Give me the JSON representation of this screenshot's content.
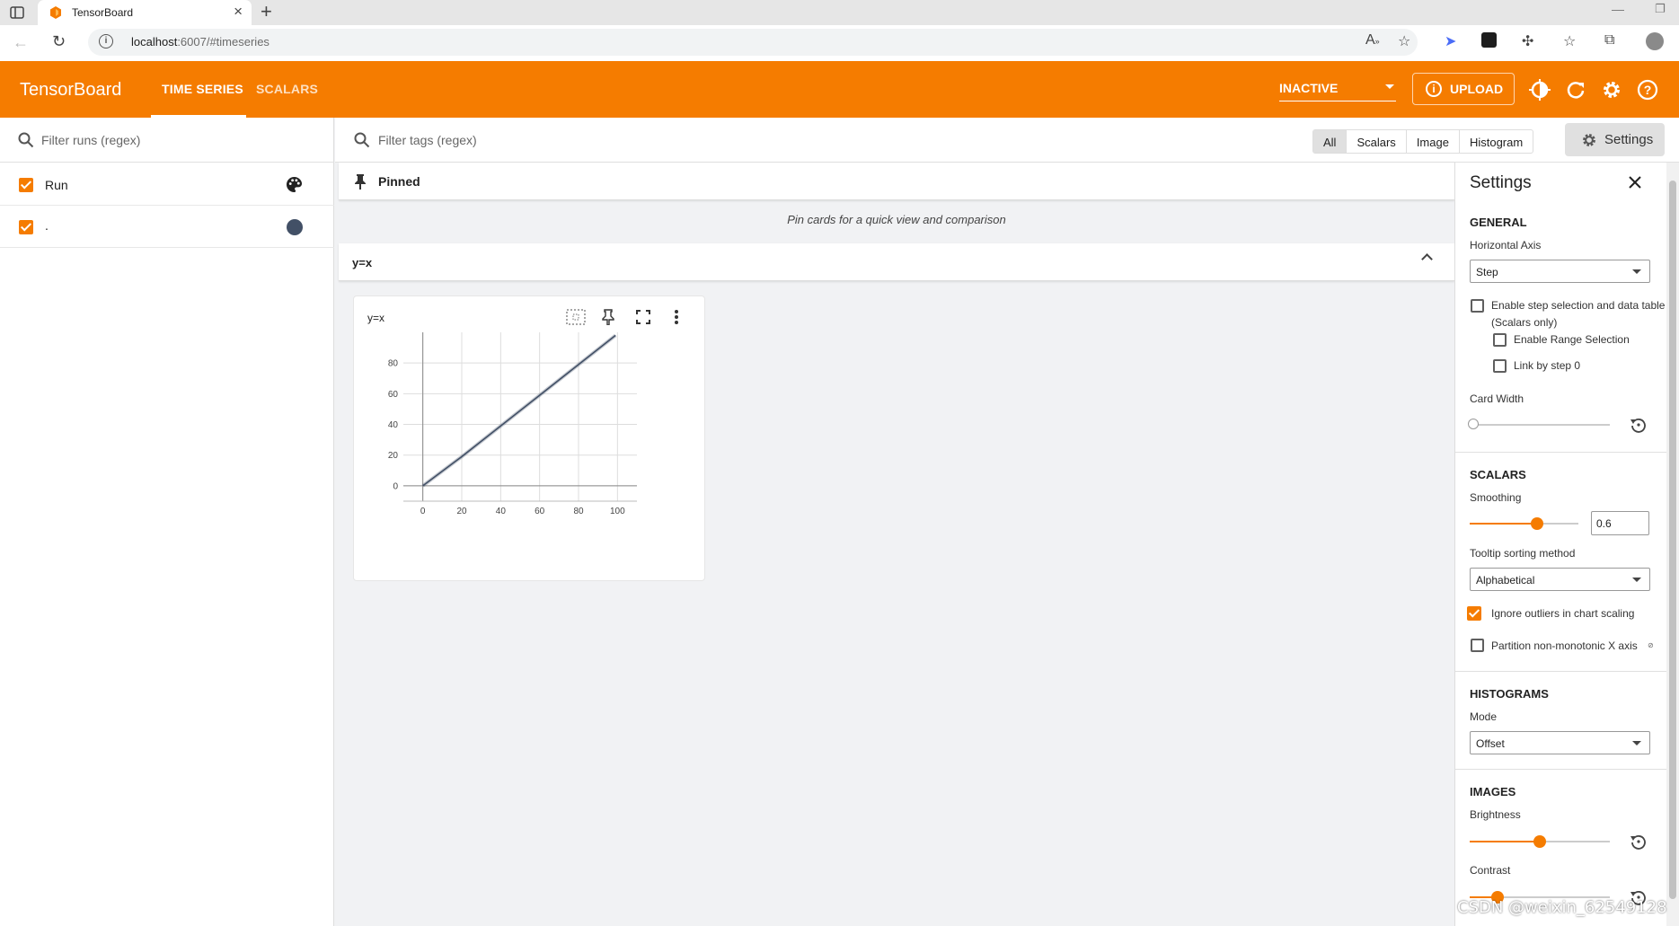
{
  "browser": {
    "tab_title": "TensorBoard",
    "url_host": "localhost",
    "url_rest": ":6007/#timeseries"
  },
  "header": {
    "logo": "TensorBoard",
    "nav": [
      "TIME SERIES",
      "SCALARS"
    ],
    "status": "INACTIVE",
    "upload": "UPLOAD"
  },
  "runs": {
    "filter_placeholder": "Filter runs (regex)",
    "header_label": "Run",
    "items": [
      {
        "name": ".",
        "color": "#425066"
      }
    ]
  },
  "main": {
    "filter_placeholder": "Filter tags (regex)",
    "types": [
      "All",
      "Scalars",
      "Image",
      "Histogram"
    ],
    "selected_type": "All",
    "settings_button": "Settings",
    "pinned_label": "Pinned",
    "pinned_empty": "Pin cards for a quick view and comparison",
    "group_label": "y=x"
  },
  "card": {
    "title": "y=x"
  },
  "chart_data": {
    "type": "line",
    "title": "y=x",
    "xticks": [
      0,
      20,
      40,
      60,
      80,
      100
    ],
    "yticks": [
      0,
      20,
      40,
      60,
      80
    ],
    "xlim": [
      -10,
      110
    ],
    "ylim": [
      -10,
      100
    ],
    "grid": true,
    "series": [
      {
        "name": ".",
        "color": "#425066",
        "x": [
          0,
          20,
          40,
          60,
          80,
          99
        ],
        "y": [
          0,
          19,
          39,
          59,
          79,
          98
        ]
      }
    ]
  },
  "settings": {
    "title": "Settings",
    "general": {
      "heading": "GENERAL",
      "horizontal_axis_label": "Horizontal Axis",
      "horizontal_axis_value": "Step",
      "step_selection": "Enable step selection and data table",
      "step_selection_note": "(Scalars only)",
      "range_selection": "Enable Range Selection",
      "link_step": "Link by step 0",
      "card_width": "Card Width"
    },
    "scalars": {
      "heading": "SCALARS",
      "smoothing_label": "Smoothing",
      "smoothing_value": "0.6",
      "tooltip_label": "Tooltip sorting method",
      "tooltip_value": "Alphabetical",
      "ignore_outliers": "Ignore outliers in chart scaling",
      "partition": "Partition non-monotonic X axis"
    },
    "histograms": {
      "heading": "HISTOGRAMS",
      "mode_label": "Mode",
      "mode_value": "Offset"
    },
    "images": {
      "heading": "IMAGES",
      "brightness": "Brightness",
      "contrast": "Contrast"
    }
  },
  "watermark": "CSDN @weixin_62549128",
  "colors": {
    "accent": "#f57c00"
  }
}
